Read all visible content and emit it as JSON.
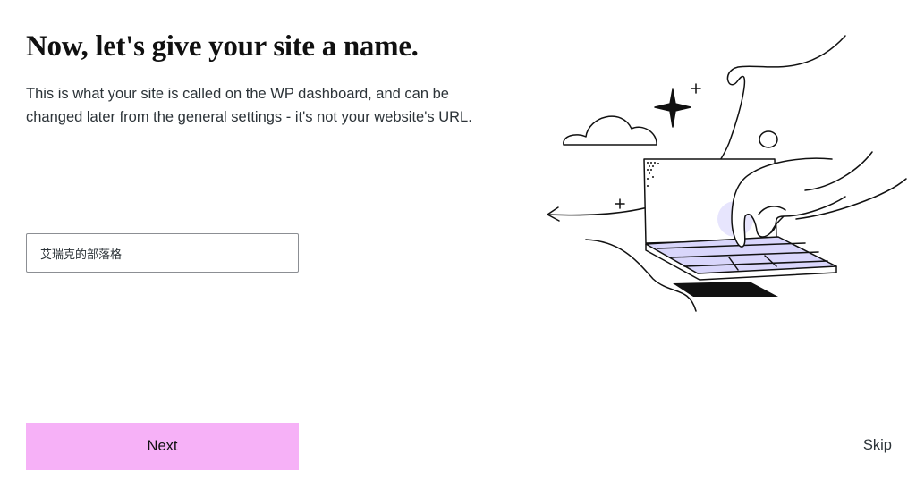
{
  "page": {
    "title": "Now, let's give your site a name.",
    "subtitle": "This is what your site is called on the WP dashboard, and can be changed later from the general settings - it's not your website's URL."
  },
  "site_name_input": {
    "value": "艾瑞克的部落格"
  },
  "actions": {
    "next_label": "Next",
    "skip_label": "Skip"
  },
  "colors": {
    "next_button_bg": "#f6b1f7",
    "keyboard_accent": "#d9d6fb"
  },
  "illustration": {
    "icons": [
      "cloud-icon",
      "sparkle-icon",
      "plus-icon",
      "laptop-icon",
      "hand-icon",
      "arrow-icon"
    ]
  }
}
